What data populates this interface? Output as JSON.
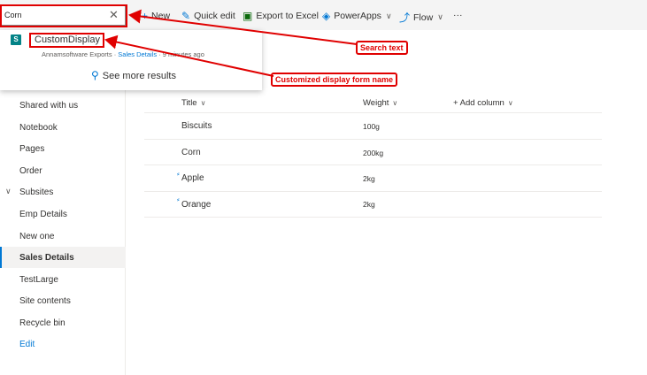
{
  "search": {
    "value": "Corn",
    "clear_icon": "close-icon"
  },
  "toolbar": {
    "new_label": "New",
    "quick_edit_label": "Quick edit",
    "export_label": "Export to Excel",
    "powerapps_label": "PowerApps",
    "flow_label": "Flow",
    "more_label": "···"
  },
  "dropdown": {
    "result": {
      "title": "CustomDisplay",
      "site": "Annamsoftware Exports",
      "separator": " · ",
      "list": "Sales Details",
      "time": "9 minutes ago"
    },
    "see_more": "See more results"
  },
  "nav": {
    "items": [
      "Shared with us",
      "Notebook",
      "Pages",
      "Order",
      "Subsites",
      "Emp Details",
      "New one",
      "Sales Details",
      "TestLarge",
      "Site contents",
      "Recycle bin",
      "Edit"
    ],
    "selected": "Sales Details"
  },
  "list": {
    "columns": [
      "Title",
      "Weight",
      "Add column"
    ],
    "rows": [
      {
        "title": "Biscuits",
        "weight": "100g"
      },
      {
        "title": "Corn",
        "weight": "200kg"
      },
      {
        "title": "Apple",
        "weight": "2kg"
      },
      {
        "title": "Orange",
        "weight": "2kg"
      }
    ]
  },
  "annotations": {
    "search_text": "Search text",
    "display_form": "Customized display form name",
    "color": "#e00000"
  }
}
